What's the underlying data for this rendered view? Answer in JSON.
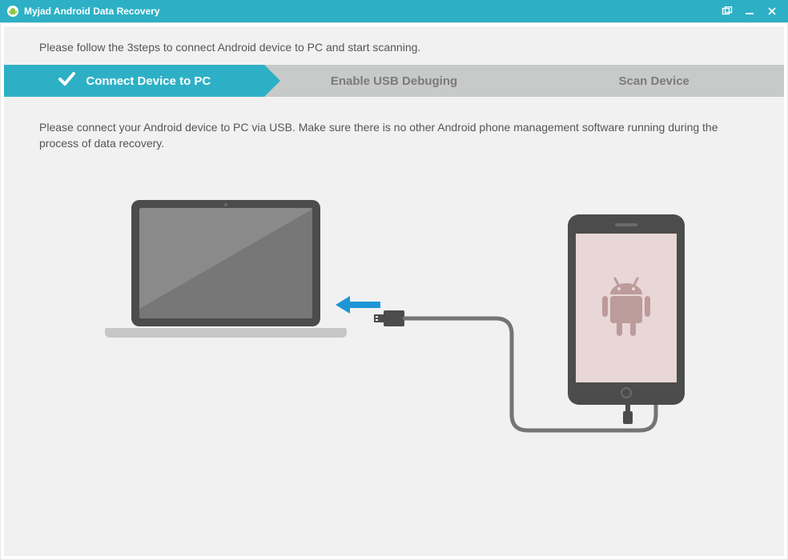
{
  "title": "Myjad Android Data Recovery",
  "intro": "Please follow the 3steps to connect Android device to PC and start scanning.",
  "steps": {
    "s1": "Connect Device to PC",
    "s2": "Enable USB Debuging",
    "s3": "Scan Device"
  },
  "bodytext": "Please connect your Android device to PC via USB. Make sure there is no other Android phone management software running during the process of data recovery.",
  "colors": {
    "accent": "#2db0c5",
    "step_inactive": "#c8c9c9",
    "text": "#555555"
  }
}
